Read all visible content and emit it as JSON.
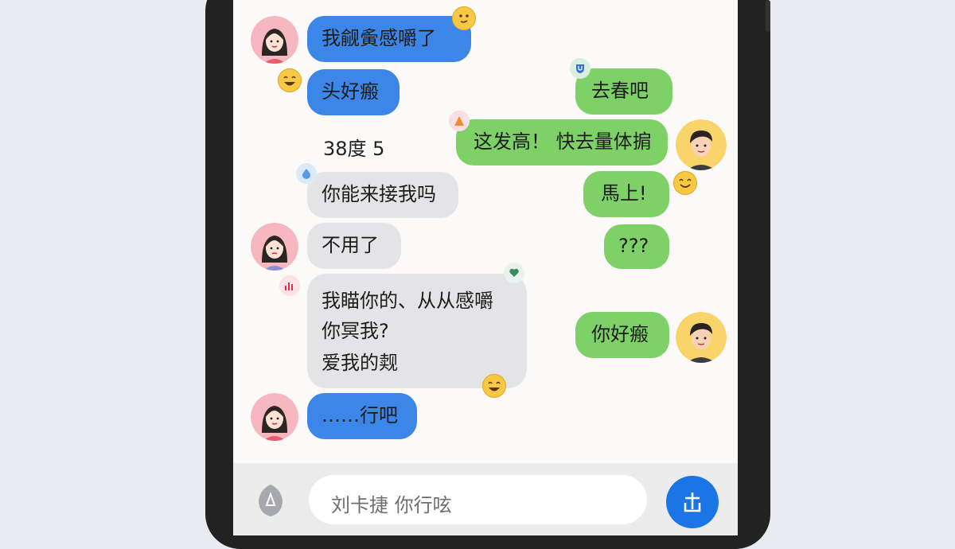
{
  "chat": {
    "messages": [
      {
        "side": "left",
        "text": "我觎夤感嚼了"
      },
      {
        "side": "left",
        "text": "头好瘢"
      },
      {
        "side": "left",
        "text": "38度 5"
      },
      {
        "side": "left",
        "text": "你能来接我吗"
      },
      {
        "side": "left",
        "text": "不用了"
      },
      {
        "side": "left",
        "lines": [
          "我瞄你的、从从感嚼",
          "你冥我?",
          "爱我的觌"
        ]
      },
      {
        "side": "left",
        "text": "……行吧"
      },
      {
        "side": "right",
        "text": "去春吧"
      },
      {
        "side": "right",
        "text": "这发高！ 快去量体掮"
      },
      {
        "side": "right",
        "text": "馬上!"
      },
      {
        "side": "right",
        "text": "???"
      },
      {
        "side": "right",
        "text": "你好瘢"
      }
    ]
  },
  "input": {
    "placeholder": "刘卡捷 你行呟",
    "send_icon": "send-icon",
    "voice_icon": "voice-icon"
  },
  "colors": {
    "blue_bubble": "#3b86e6",
    "gray_bubble": "#e4e4e6",
    "green_bubble": "#7ed166",
    "send_button": "#1c75e4"
  }
}
